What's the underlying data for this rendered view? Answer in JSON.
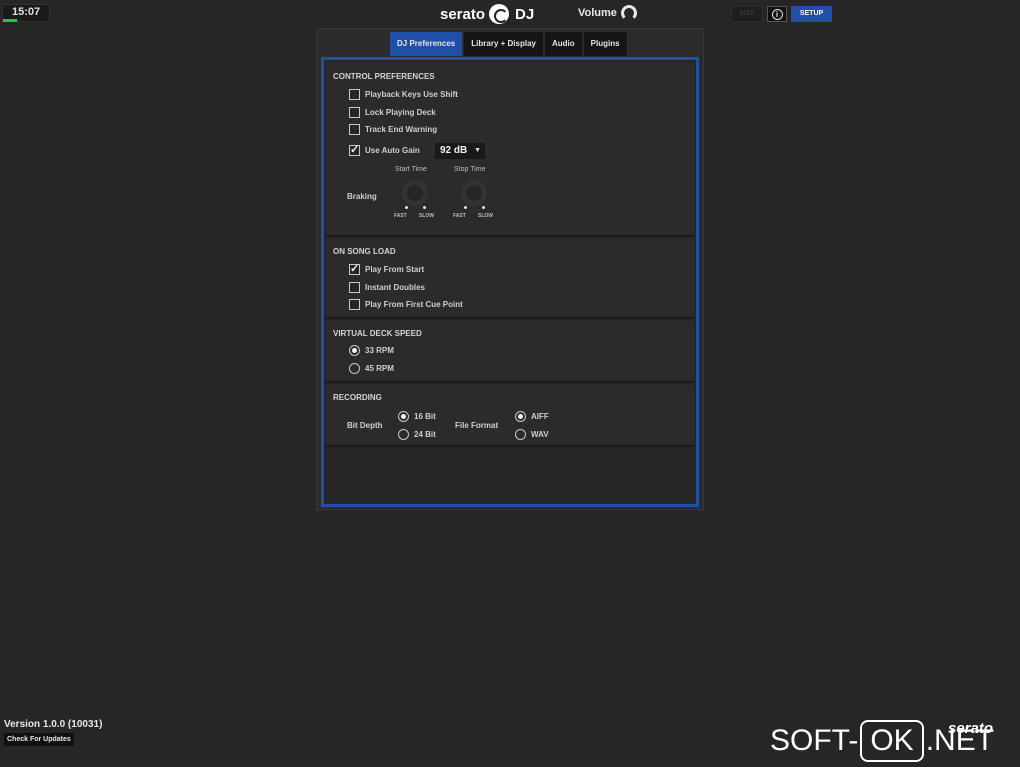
{
  "topbar": {
    "clock": "15:07",
    "logo_text": "serato",
    "logo_suffix": "DJ",
    "volume_label": "Volume",
    "midi_label": "MIDI",
    "info_label": "i",
    "setup_label": "SETUP"
  },
  "tabs": [
    {
      "label": "DJ Preferences"
    },
    {
      "label": "Library + Display"
    },
    {
      "label": "Audio"
    },
    {
      "label": "Plugins"
    }
  ],
  "control_preferences": {
    "title": "CONTROL PREFERENCES",
    "playback_keys": "Playback Keys Use Shift",
    "lock_playing_deck": "Lock Playing Deck",
    "track_end_warning": "Track End Warning",
    "use_auto_gain": "Use Auto Gain",
    "auto_gain_value": "92 dB",
    "auto_gain_arrow": "▼",
    "braking": "Braking",
    "start_time": "Start Time",
    "stop_time": "Stop Time",
    "fast": "FAST",
    "slow": "SLOW",
    "checked": {
      "playback_keys": false,
      "lock_playing_deck": false,
      "track_end_warning": false,
      "use_auto_gain": true
    }
  },
  "on_song_load": {
    "title": "ON SONG LOAD",
    "play_from_start": "Play From Start",
    "instant_doubles": "Instant Doubles",
    "play_from_first_cue": "Play From First Cue Point",
    "checked": {
      "play_from_start": true,
      "instant_doubles": false,
      "play_from_first_cue": false
    }
  },
  "virtual_deck_speed": {
    "title": "VIRTUAL DECK SPEED",
    "rpm33": "33 RPM",
    "rpm45": "45 RPM",
    "selected": "33 RPM"
  },
  "recording": {
    "title": "RECORDING",
    "bit_depth": "Bit Depth",
    "bit16": "16 Bit",
    "bit24": "24 Bit",
    "file_format": "File Format",
    "aiff": "AIFF",
    "wav": "WAV",
    "selected_bit_depth": "16 Bit",
    "selected_format": "AIFF"
  },
  "footer": {
    "version": "Version 1.0.0 (10031)",
    "check_updates": "Check For Updates",
    "brand_corner": "serato"
  },
  "watermark": {
    "left": "SOFT-",
    "box": "OK",
    "right": ".NET"
  },
  "colors": {
    "accent": "#1f4fa8",
    "background": "#262626",
    "clock_bar": "#2fc13a"
  }
}
